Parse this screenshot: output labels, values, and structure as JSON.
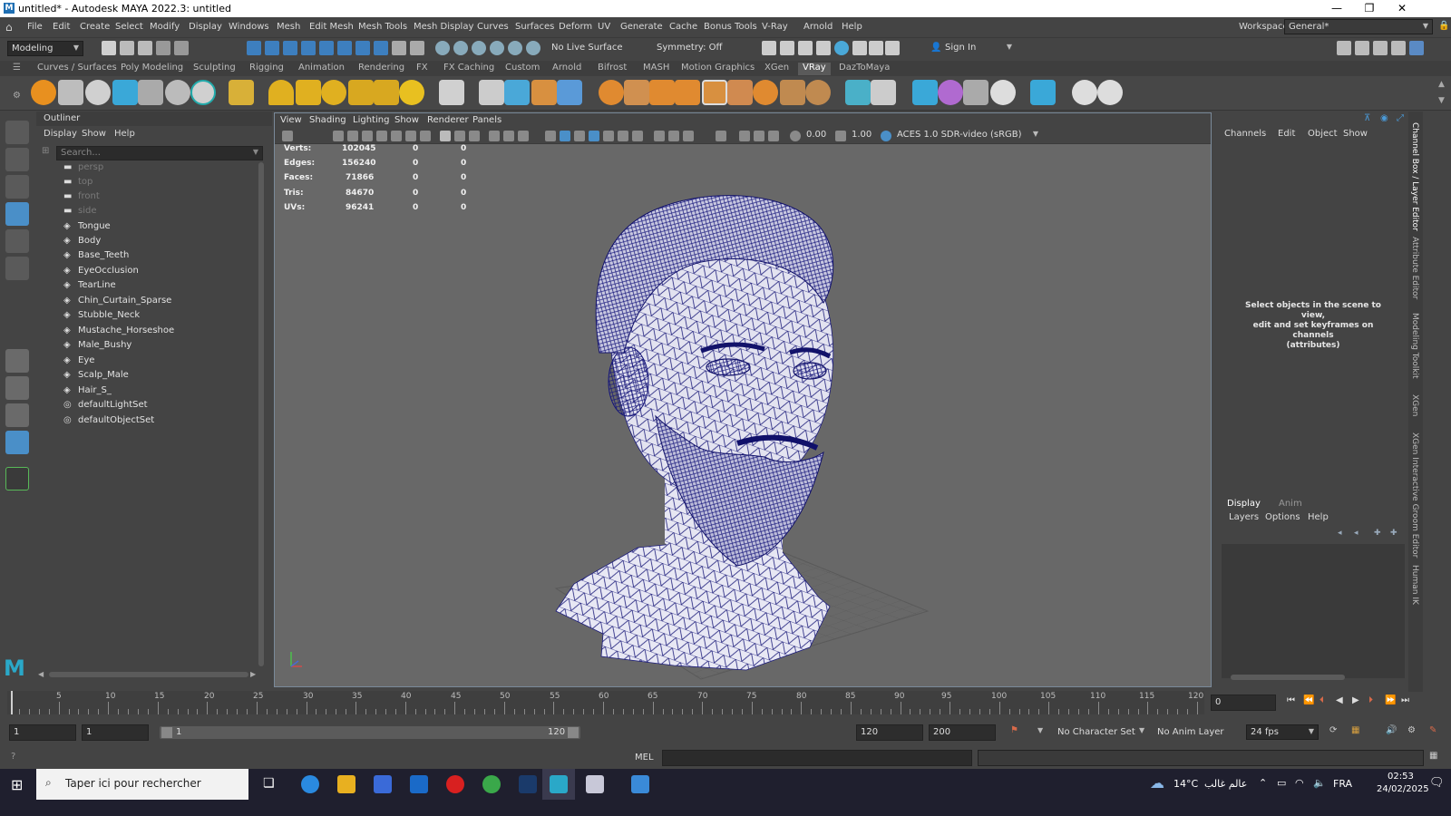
{
  "window": {
    "title": "untitled* - Autodesk MAYA 2022.3: untitled",
    "icon_letter": "M",
    "minimize_glyph": "—",
    "maximize_glyph": "❐",
    "close_glyph": "✕"
  },
  "menubar": {
    "items": [
      "File",
      "Edit",
      "Create",
      "Select",
      "Modify",
      "Display",
      "Windows",
      "Mesh",
      "Edit Mesh",
      "Mesh Tools",
      "Mesh Display",
      "Curves",
      "Surfaces",
      "Deform",
      "UV",
      "Generate",
      "Cache",
      "Bonus Tools",
      "V-Ray",
      "Arnold",
      "Help"
    ],
    "workspace_label": "Workspace:",
    "workspace_value": "General*"
  },
  "statusline": {
    "mode": "Modeling",
    "live_surface": "No Live Surface",
    "symmetry": "Symmetry: Off",
    "sign_in": "Sign In"
  },
  "shelf": {
    "tabs": [
      "Curves / Surfaces",
      "Poly Modeling",
      "Sculpting",
      "Rigging",
      "Animation",
      "Rendering",
      "FX",
      "FX Caching",
      "Custom",
      "Arnold",
      "Bifrost",
      "MASH",
      "Motion Graphics",
      "XGen",
      "VRay",
      "DazToMaya"
    ],
    "active_tab": "VRay"
  },
  "outliner": {
    "title": "Outliner",
    "menus": [
      "Display",
      "Show",
      "Help"
    ],
    "search_placeholder": "Search...",
    "cameras": [
      "persp",
      "top",
      "front",
      "side"
    ],
    "nodes": [
      "Tongue",
      "Body",
      "Base_Teeth",
      "EyeOcclusion",
      "TearLine",
      "Chin_Curtain_Sparse",
      "Stubble_Neck",
      "Mustache_Horseshoe",
      "Male_Bushy",
      "Eye",
      "Scalp_Male",
      "Hair_S_"
    ],
    "sets": [
      "defaultLightSet",
      "defaultObjectSet"
    ]
  },
  "viewport": {
    "menus": [
      "View",
      "Shading",
      "Lighting",
      "Show",
      "Renderer",
      "Panels"
    ],
    "exposure": "0.00",
    "gamma": "1.00",
    "color_space": "ACES 1.0 SDR-video (sRGB)",
    "hud": [
      {
        "label": "Verts:",
        "v1": "102045",
        "v2": "0",
        "v3": "0"
      },
      {
        "label": "Edges:",
        "v1": "156240",
        "v2": "0",
        "v3": "0"
      },
      {
        "label": "Faces:",
        "v1": "71866",
        "v2": "0",
        "v3": "0"
      },
      {
        "label": "Tris:",
        "v1": "84670",
        "v2": "0",
        "v3": "0"
      },
      {
        "label": "UVs:",
        "v1": "96241",
        "v2": "0",
        "v3": "0"
      }
    ]
  },
  "channelbox": {
    "menus": [
      "Channels",
      "Edit",
      "Object",
      "Show"
    ],
    "message_line1": "Select objects in the scene to view,",
    "message_line2": "edit and set keyframes on channels",
    "message_line3": "(attributes)"
  },
  "layers": {
    "tabs": [
      "Display",
      "Anim"
    ],
    "menus": [
      "Layers",
      "Options",
      "Help"
    ]
  },
  "right_tabs": [
    "Channel Box / Layer Editor",
    "Attribute Editor",
    "Modeling Toolkit",
    "XGen",
    "XGen Interactive Groom Editor",
    "Human IK"
  ],
  "timeslider": {
    "labels": [
      "5",
      "10",
      "15",
      "20",
      "25",
      "30",
      "35",
      "40",
      "45",
      "50",
      "55",
      "60",
      "65",
      "70",
      "75",
      "80",
      "85",
      "90",
      "95",
      "100",
      "105",
      "110",
      "115",
      "120"
    ],
    "current_frame": "0"
  },
  "range": {
    "start": "1",
    "start2": "1",
    "slider_start": "1",
    "slider_end": "120",
    "end": "120",
    "end2": "200",
    "character_set": "No Character Set",
    "anim_layer": "No Anim Layer",
    "fps": "24 fps"
  },
  "cmdline": {
    "lang": "MEL"
  },
  "taskbar": {
    "search_placeholder": "Taper ici pour rechercher",
    "weather": "14°C",
    "weather_text": "عالم غالب",
    "lang": "FRA",
    "time": "02:53",
    "date": "24/02/2025"
  }
}
